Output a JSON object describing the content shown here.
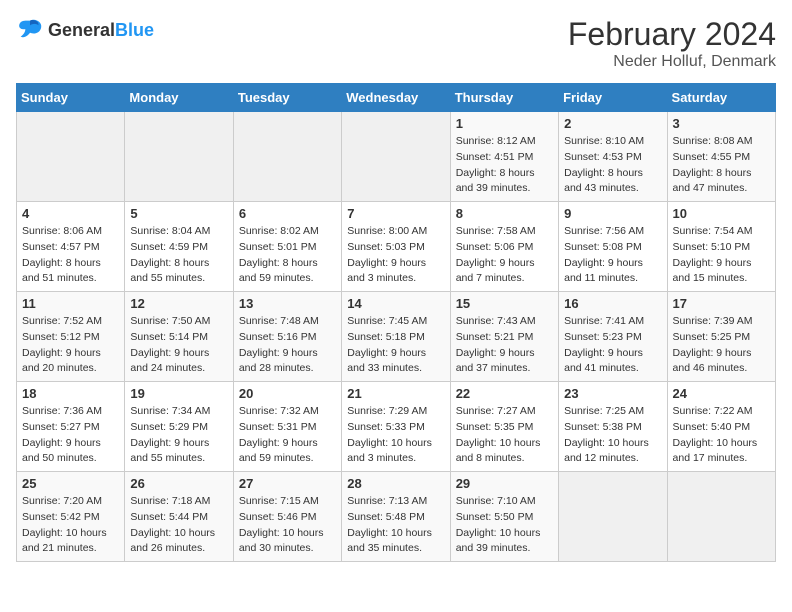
{
  "header": {
    "logo_general": "General",
    "logo_blue": "Blue",
    "title": "February 2024",
    "subtitle": "Neder Holluf, Denmark"
  },
  "calendar": {
    "days_of_week": [
      "Sunday",
      "Monday",
      "Tuesday",
      "Wednesday",
      "Thursday",
      "Friday",
      "Saturday"
    ],
    "weeks": [
      [
        {
          "date": "",
          "info": ""
        },
        {
          "date": "",
          "info": ""
        },
        {
          "date": "",
          "info": ""
        },
        {
          "date": "",
          "info": ""
        },
        {
          "date": "1",
          "info": "Sunrise: 8:12 AM\nSunset: 4:51 PM\nDaylight: 8 hours\nand 39 minutes."
        },
        {
          "date": "2",
          "info": "Sunrise: 8:10 AM\nSunset: 4:53 PM\nDaylight: 8 hours\nand 43 minutes."
        },
        {
          "date": "3",
          "info": "Sunrise: 8:08 AM\nSunset: 4:55 PM\nDaylight: 8 hours\nand 47 minutes."
        }
      ],
      [
        {
          "date": "4",
          "info": "Sunrise: 8:06 AM\nSunset: 4:57 PM\nDaylight: 8 hours\nand 51 minutes."
        },
        {
          "date": "5",
          "info": "Sunrise: 8:04 AM\nSunset: 4:59 PM\nDaylight: 8 hours\nand 55 minutes."
        },
        {
          "date": "6",
          "info": "Sunrise: 8:02 AM\nSunset: 5:01 PM\nDaylight: 8 hours\nand 59 minutes."
        },
        {
          "date": "7",
          "info": "Sunrise: 8:00 AM\nSunset: 5:03 PM\nDaylight: 9 hours\nand 3 minutes."
        },
        {
          "date": "8",
          "info": "Sunrise: 7:58 AM\nSunset: 5:06 PM\nDaylight: 9 hours\nand 7 minutes."
        },
        {
          "date": "9",
          "info": "Sunrise: 7:56 AM\nSunset: 5:08 PM\nDaylight: 9 hours\nand 11 minutes."
        },
        {
          "date": "10",
          "info": "Sunrise: 7:54 AM\nSunset: 5:10 PM\nDaylight: 9 hours\nand 15 minutes."
        }
      ],
      [
        {
          "date": "11",
          "info": "Sunrise: 7:52 AM\nSunset: 5:12 PM\nDaylight: 9 hours\nand 20 minutes."
        },
        {
          "date": "12",
          "info": "Sunrise: 7:50 AM\nSunset: 5:14 PM\nDaylight: 9 hours\nand 24 minutes."
        },
        {
          "date": "13",
          "info": "Sunrise: 7:48 AM\nSunset: 5:16 PM\nDaylight: 9 hours\nand 28 minutes."
        },
        {
          "date": "14",
          "info": "Sunrise: 7:45 AM\nSunset: 5:18 PM\nDaylight: 9 hours\nand 33 minutes."
        },
        {
          "date": "15",
          "info": "Sunrise: 7:43 AM\nSunset: 5:21 PM\nDaylight: 9 hours\nand 37 minutes."
        },
        {
          "date": "16",
          "info": "Sunrise: 7:41 AM\nSunset: 5:23 PM\nDaylight: 9 hours\nand 41 minutes."
        },
        {
          "date": "17",
          "info": "Sunrise: 7:39 AM\nSunset: 5:25 PM\nDaylight: 9 hours\nand 46 minutes."
        }
      ],
      [
        {
          "date": "18",
          "info": "Sunrise: 7:36 AM\nSunset: 5:27 PM\nDaylight: 9 hours\nand 50 minutes."
        },
        {
          "date": "19",
          "info": "Sunrise: 7:34 AM\nSunset: 5:29 PM\nDaylight: 9 hours\nand 55 minutes."
        },
        {
          "date": "20",
          "info": "Sunrise: 7:32 AM\nSunset: 5:31 PM\nDaylight: 9 hours\nand 59 minutes."
        },
        {
          "date": "21",
          "info": "Sunrise: 7:29 AM\nSunset: 5:33 PM\nDaylight: 10 hours\nand 3 minutes."
        },
        {
          "date": "22",
          "info": "Sunrise: 7:27 AM\nSunset: 5:35 PM\nDaylight: 10 hours\nand 8 minutes."
        },
        {
          "date": "23",
          "info": "Sunrise: 7:25 AM\nSunset: 5:38 PM\nDaylight: 10 hours\nand 12 minutes."
        },
        {
          "date": "24",
          "info": "Sunrise: 7:22 AM\nSunset: 5:40 PM\nDaylight: 10 hours\nand 17 minutes."
        }
      ],
      [
        {
          "date": "25",
          "info": "Sunrise: 7:20 AM\nSunset: 5:42 PM\nDaylight: 10 hours\nand 21 minutes."
        },
        {
          "date": "26",
          "info": "Sunrise: 7:18 AM\nSunset: 5:44 PM\nDaylight: 10 hours\nand 26 minutes."
        },
        {
          "date": "27",
          "info": "Sunrise: 7:15 AM\nSunset: 5:46 PM\nDaylight: 10 hours\nand 30 minutes."
        },
        {
          "date": "28",
          "info": "Sunrise: 7:13 AM\nSunset: 5:48 PM\nDaylight: 10 hours\nand 35 minutes."
        },
        {
          "date": "29",
          "info": "Sunrise: 7:10 AM\nSunset: 5:50 PM\nDaylight: 10 hours\nand 39 minutes."
        },
        {
          "date": "",
          "info": ""
        },
        {
          "date": "",
          "info": ""
        }
      ]
    ]
  }
}
